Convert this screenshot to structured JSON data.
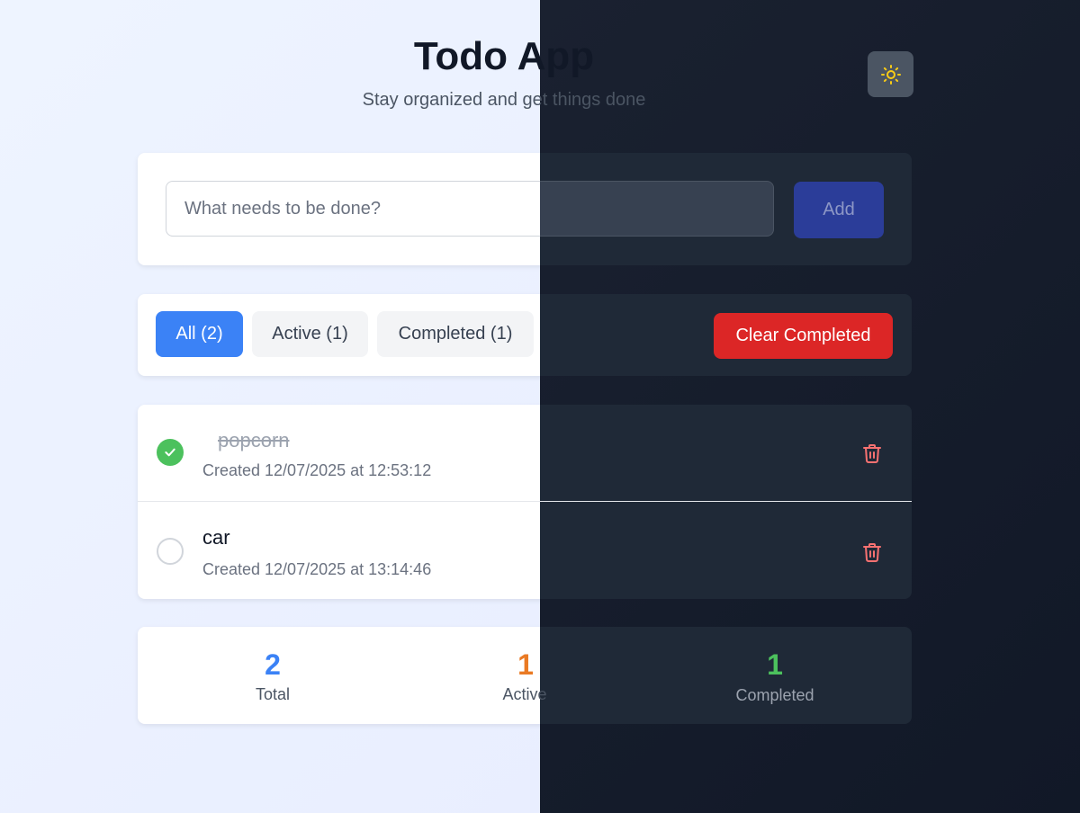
{
  "header": {
    "title": "Todo App",
    "subtitle": "Stay organized and get things done",
    "theme_icon": "sun-icon"
  },
  "add": {
    "placeholder": "What needs to be done?",
    "button_label": "Add"
  },
  "filters": {
    "items": [
      {
        "label": "All (2)",
        "selected": true
      },
      {
        "label": "Active (1)",
        "selected": false
      },
      {
        "label": "Completed (1)",
        "selected": false
      }
    ],
    "clear_label": "Clear Completed"
  },
  "todos": [
    {
      "text": "popcorn",
      "completed": true,
      "created": "Created 12/07/2025 at 12:53:12"
    },
    {
      "text": "car",
      "completed": false,
      "created": "Created 12/07/2025 at 13:14:46"
    }
  ],
  "stats": {
    "total": {
      "value": "2",
      "label": "Total"
    },
    "active": {
      "value": "1",
      "label": "Active"
    },
    "completed": {
      "value": "1",
      "label": "Completed"
    }
  },
  "colors": {
    "primary": "#3b82f6",
    "danger": "#dc2626",
    "success": "#4cc15d",
    "warning": "#ea7a24"
  }
}
